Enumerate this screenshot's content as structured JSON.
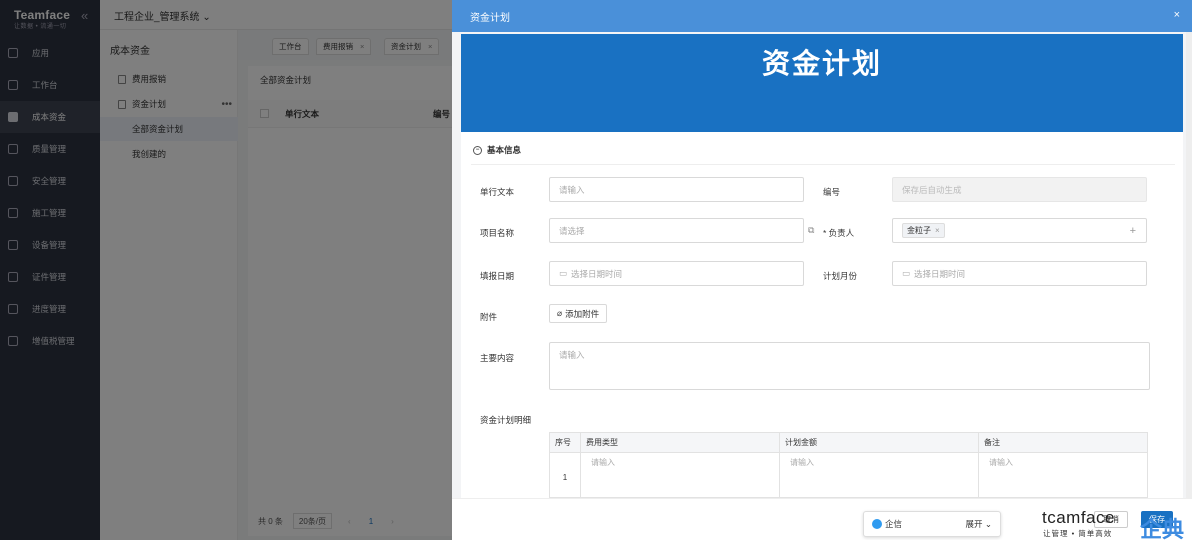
{
  "nav": {
    "logo": "Teamface",
    "logo_sub": "让数据 • 流通一切",
    "items": [
      {
        "label": "应用",
        "icon": "apps-icon"
      },
      {
        "label": "工作台",
        "icon": "workbench-icon"
      },
      {
        "label": "成本资金",
        "icon": "cost-fund-icon"
      },
      {
        "label": "质量管理",
        "icon": "quality-icon"
      },
      {
        "label": "安全管理",
        "icon": "safety-icon"
      },
      {
        "label": "施工管理",
        "icon": "construction-icon"
      },
      {
        "label": "设备管理",
        "icon": "equipment-icon"
      },
      {
        "label": "证件管理",
        "icon": "certificate-icon"
      },
      {
        "label": "进度管理",
        "icon": "progress-icon"
      },
      {
        "label": "增值税管理",
        "icon": "vat-icon"
      }
    ]
  },
  "topbar": {
    "system": "工程企业_管理系统"
  },
  "sidebar": {
    "title": "成本资金",
    "items": [
      "费用报销",
      "资金计划"
    ],
    "children": [
      "全部资金计划",
      "我创建的"
    ]
  },
  "tabs": [
    "工作台",
    "费用报销",
    "资金计划"
  ],
  "list": {
    "title": "全部资金计划",
    "columns": [
      "单行文本",
      "编号"
    ],
    "total": "共 0 条",
    "page_size": "20条/页",
    "page": "1"
  },
  "drawer": {
    "title": "资金计划",
    "banner": "资金计划",
    "section": "基本信息",
    "fields": {
      "text_label": "单行文本",
      "text_placeholder": "请输入",
      "code_label": "编号",
      "code_placeholder": "保存后自动生成",
      "project_label": "项目名称",
      "project_placeholder": "请选择",
      "owner_label": "* 负责人",
      "owner_tag": "金粒子",
      "date_label": "填报日期",
      "date_placeholder": "选择日期时间",
      "month_label": "计划月份",
      "month_placeholder": "选择日期时间",
      "attach_label": "附件",
      "attach_button": "添加附件",
      "content_label": "主要内容",
      "content_placeholder": "请输入",
      "detail_label": "资金计划明细"
    },
    "detail_table": {
      "columns": [
        "序号",
        "费用类型",
        "计划金额",
        "备注"
      ],
      "row": {
        "index": "1",
        "placeholder": "请输入"
      }
    },
    "footer": {
      "im": "企信",
      "expand": "展开",
      "cancel": "取消",
      "save": "保存"
    }
  },
  "watermark": {
    "brand": "tcamface",
    "sub": "让管理 • 简单高效",
    "cn": "企典"
  },
  "colors": {
    "nav_bg": "#2d3340",
    "drawer_header": "#4a90d9",
    "banner": "#1971c2",
    "primary": "#1971c2"
  }
}
